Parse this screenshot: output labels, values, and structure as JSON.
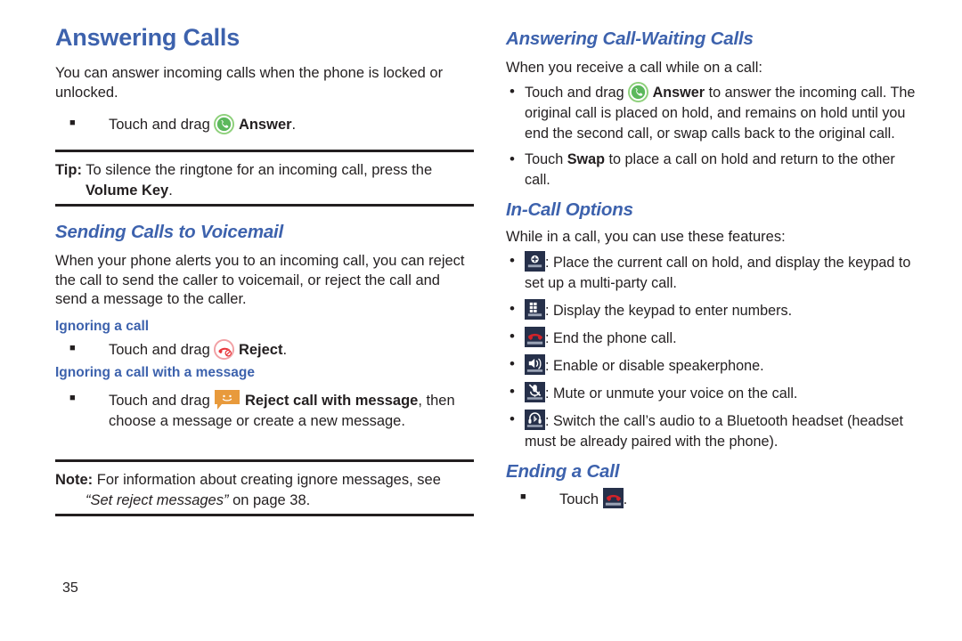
{
  "page": {
    "number": "35",
    "accent_heading_color": "#3d62ad",
    "body_color": "#231f20"
  },
  "left_column": {
    "title": "Answering Calls",
    "intro": "You can answer incoming calls when the phone is locked or unlocked.",
    "answer_step": {
      "prefix": "Touch and drag ",
      "icon": "answer-call-icon",
      "bold": "Answer",
      "suffix": "."
    },
    "tip": {
      "label": "Tip:",
      "text": " To silence the ringtone for an incoming call, press the ",
      "bold": "Volume Key",
      "suffix": "."
    },
    "voicemail": {
      "heading": "Sending Calls to Voicemail",
      "paragraph": "When your phone alerts you to an incoming call, you can reject the call to send the caller to voicemail, or reject the call and send a message to the caller."
    },
    "ignoring_call": {
      "heading": "Ignoring a call",
      "step": {
        "prefix": "Touch and drag ",
        "icon": "reject-call-icon",
        "bold": "Reject",
        "suffix": "."
      }
    },
    "ignoring_with_message": {
      "heading": "Ignoring a call with a message",
      "step": {
        "prefix": "Touch and drag ",
        "icon": "reject-with-message-icon",
        "bold": "Reject call with message",
        "suffix": ", then choose a message or create a new message."
      }
    },
    "note": {
      "label": "Note:",
      "text": " For information about creating ignore messages, see ",
      "italic": "“Set reject messages”",
      "suffix": " on page 38."
    }
  },
  "right_column": {
    "call_waiting": {
      "heading": "Answering Call-Waiting Calls",
      "intro": "When you receive a call while on a call:",
      "bullets": [
        {
          "prefix": "Touch and drag ",
          "icon": "answer-call-icon",
          "bold": "Answer",
          "suffix": " to answer the incoming call. The original call is placed on hold, and remains on hold until you end the second call, or swap calls back to the original call."
        },
        {
          "prefix": "Touch ",
          "icon": null,
          "bold": "Swap",
          "suffix": " to place a call on hold and return to the other call."
        }
      ]
    },
    "in_call_options": {
      "heading": "In-Call Options",
      "intro": "While in a call, you can use these features:",
      "items": [
        {
          "icon": "add-call-icon",
          "icon_label": "Add call",
          "text": ": Place the current call on hold, and display the keypad to set up a multi-party call."
        },
        {
          "icon": "keypad-icon",
          "icon_label": "Keypad",
          "text": ": Display the keypad to enter numbers."
        },
        {
          "icon": "end-call-icon",
          "icon_label": "End call",
          "text": ": End the phone call."
        },
        {
          "icon": "speaker-icon",
          "icon_label": "Speaker",
          "text": ": Enable or disable speakerphone."
        },
        {
          "icon": "mute-icon",
          "icon_label": "Mute",
          "text": ": Mute or unmute your voice on the call."
        },
        {
          "icon": "headset-icon",
          "icon_label": "Headset",
          "text": ": Switch the call’s audio to a Bluetooth headset (headset must be already paired with the phone)."
        }
      ]
    },
    "ending_call": {
      "heading": "Ending a Call",
      "step": {
        "prefix": "Touch ",
        "icon": "end-call-icon",
        "suffix": "."
      }
    }
  },
  "icon_colors": {
    "answer_green": "#4caf50",
    "answer_ring": "#8dd07a",
    "reject_red": "#e8353a",
    "reject_ring": "#f1a0a4",
    "message_orange": "#e89a3c",
    "tile_navy": "#26304a",
    "end_call_red": "#d2232a"
  }
}
